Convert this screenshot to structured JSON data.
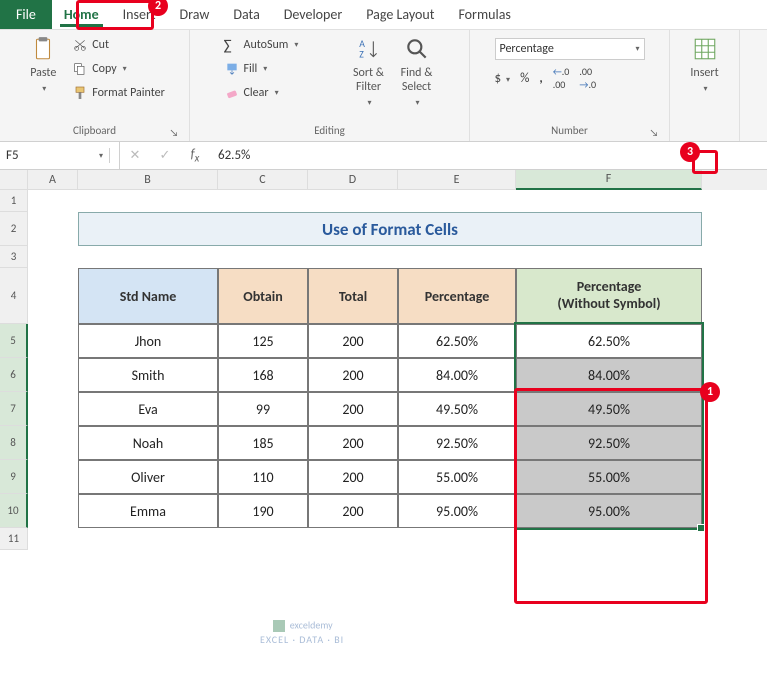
{
  "tabs": {
    "file": "File",
    "home": "Home",
    "insert": "Insert",
    "draw": "Draw",
    "data": "Data",
    "developer": "Developer",
    "pagelayout": "Page Layout",
    "formulas": "Formulas"
  },
  "clipboard": {
    "paste": "Paste",
    "cut": "Cut",
    "copy": "Copy",
    "fmtpainter": "Format Painter",
    "label": "Clipboard"
  },
  "editing": {
    "autosum": "AutoSum",
    "fill": "Fill",
    "clear": "Clear",
    "sortfilter": "Sort &\nFilter",
    "findselect": "Find &\nSelect",
    "label": "Editing"
  },
  "number": {
    "format": "Percentage",
    "dollar": "$",
    "pct": "%",
    "comma": ",",
    "inc": ".00",
    "dec": ".00",
    "label": "Number"
  },
  "insertgrp": {
    "insert": "Insert"
  },
  "namebox": "F5",
  "fxvalue": "62.5%",
  "cols": [
    "A",
    "B",
    "C",
    "D",
    "E",
    "F"
  ],
  "title": "Use of Format Cells",
  "headers": {
    "b": "Std Name",
    "c": "Obtain",
    "d": "Total",
    "e": "Percentage",
    "f1": "Percentage",
    "f2": "(Without Symbol)"
  },
  "rows": [
    {
      "name": "Jhon",
      "obtain": "125",
      "total": "200",
      "pct": "62.50%",
      "pctns": "62.50%"
    },
    {
      "name": "Smith",
      "obtain": "168",
      "total": "200",
      "pct": "84.00%",
      "pctns": "84.00%"
    },
    {
      "name": "Eva",
      "obtain": "99",
      "total": "200",
      "pct": "49.50%",
      "pctns": "49.50%"
    },
    {
      "name": "Noah",
      "obtain": "185",
      "total": "200",
      "pct": "92.50%",
      "pctns": "92.50%"
    },
    {
      "name": "Oliver",
      "obtain": "110",
      "total": "200",
      "pct": "55.00%",
      "pctns": "55.00%"
    },
    {
      "name": "Emma",
      "obtain": "190",
      "total": "200",
      "pct": "95.00%",
      "pctns": "95.00%"
    }
  ],
  "watermark": {
    "l1": "exceldemy",
    "l2": "EXCEL · DATA · BI"
  },
  "callouts": {
    "c1": "1",
    "c2": "2",
    "c3": "3"
  }
}
